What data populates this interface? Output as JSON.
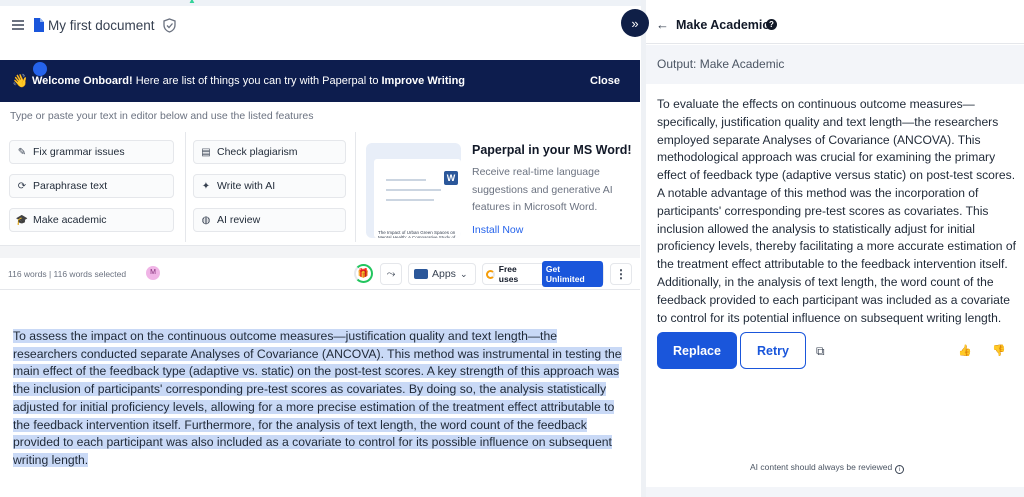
{
  "header": {
    "doc_title": "My first document",
    "collapse_glyph": "»"
  },
  "banner": {
    "emoji": "👋",
    "prefix": "Welcome Onboard!",
    "middle": " Here are list of things you can try with Paperpal to ",
    "suffix": "Improve Writing",
    "close": "Close"
  },
  "features": {
    "hint": "Type or paste your text in editor below and use the listed features",
    "items": [
      {
        "label": "Fix grammar issues",
        "icon": "pen-icon"
      },
      {
        "label": "Check plagiarism",
        "icon": "document-check-icon"
      },
      {
        "label": "Paraphrase text",
        "icon": "refresh-icon"
      },
      {
        "label": "Write with AI",
        "icon": "sparkle-icon"
      },
      {
        "label": "Make academic",
        "icon": "graduation-cap-icon"
      },
      {
        "label": "AI review",
        "icon": "globe-icon"
      }
    ],
    "msword": {
      "title": "Paperpal in your MS Word!",
      "desc": "Receive real-time language suggestions and generative AI features in Microsoft Word.",
      "link": "Install Now",
      "thumb_text": "The Impact of Urban Green Spaces on Mental Health: A Comparative Study of Major Metropolitan Areas"
    }
  },
  "toolbar": {
    "word_count": "116 words | 116 words selected",
    "avatar_initial": "M",
    "apps_label": "Apps",
    "free_label": "Free uses",
    "unlimited_label": "Get Unlimited"
  },
  "editor": {
    "text": "To assess the impact on the continuous outcome measures—justification quality and text length—the researchers conducted separate Analyses of Covariance (ANCOVA). This method was instrumental in testing the main effect of the feedback type (adaptive vs. static) on the post-test scores. A key strength of this approach was the inclusion of participants' corresponding pre-test scores as covariates. By doing so, the analysis statistically adjusted for initial proficiency levels, allowing for a more precise estimation of the treatment effect attributable to the feedback intervention itself. Furthermore, for the analysis of text length, the word count of the feedback provided to each participant was also included as a covariate to control for its possible influence on subsequent writing length."
  },
  "panel": {
    "title": "Make Academic",
    "output_label": "Output: Make Academic",
    "output_text": "To evaluate the effects on continuous outcome measures—specifically, justification quality and text length—the researchers employed separate Analyses of Covariance (ANCOVA). This methodological approach was crucial for examining the primary effect of feedback type (adaptive versus static) on post-test scores. A notable advantage of this method was the incorporation of participants' corresponding pre-test scores as covariates. This inclusion allowed the analysis to statistically adjust for initial proficiency levels, thereby facilitating a more accurate estimation of the treatment effect attributable to the feedback intervention itself. Additionally, in the analysis of text length, the word count of the feedback provided to each participant was included as a covariate to control for its potential influence on subsequent writing length.",
    "replace_label": "Replace",
    "retry_label": "Retry",
    "disclaimer": "AI content should always be reviewed"
  },
  "colors": {
    "brand_navy": "#0d1d4e",
    "primary_blue": "#1a56db",
    "selection_highlight": "#c9d9f6"
  }
}
